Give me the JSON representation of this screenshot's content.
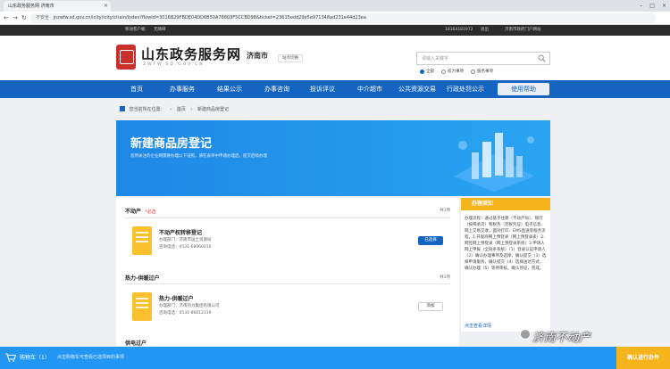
{
  "browser": {
    "tab_title": "山东政务服务网 济南市",
    "url_insecure": "不安全",
    "url": "jnzwfw.sd.gov.cn/icity/icity/chain/index?flowId=3016B29FBDE04DD6B50A78803F5CCBD98&ticket=23615edd29e5e971348ad231e44d23ea"
  },
  "topbar": {
    "left": "移动客户端",
    "left2": "无障碍",
    "phone": "18364181972",
    "logout": "退出",
    "portal": "济南市政府门户网站"
  },
  "header": {
    "title": "山东政务服务网",
    "subtitle": "ZWFW.SD.GOV.CN",
    "city": "济南市",
    "city_switch": "站点切换",
    "search_placeholder": "请输入关键字",
    "radios": [
      {
        "label": "全部",
        "selected": true
      },
      {
        "label": "权力事项",
        "selected": false
      },
      {
        "label": "服务事项",
        "selected": false
      }
    ]
  },
  "nav": {
    "items": [
      "首页",
      "办事服务",
      "结果公示",
      "办事咨询",
      "投诉评议",
      "中介超市",
      "公共资源交易",
      "行政处罚公示"
    ],
    "cta": "使用帮助"
  },
  "breadcrumb": {
    "prefix": "您当前所在位置：",
    "home": "首页",
    "current": "新建商品房登记"
  },
  "banner": {
    "title": "新建商品房登记",
    "subtitle": "您所关注的企业网需要办理以下证照，请在表单中申请办理后，提交后续办理"
  },
  "sections": [
    {
      "title": "不动产",
      "tag": "*必选",
      "count": "共1项"
    },
    {
      "title": "热力-供暖过户",
      "count": "共1项"
    },
    {
      "title": "供电过户"
    }
  ],
  "cards": [
    {
      "title": "不动产权转移登记",
      "dept": "办理部门：济南市国土资源局",
      "phone": "咨询电话：0531-68966010",
      "action": "已选择"
    },
    {
      "title": "热力-供暖过户",
      "dept": "办理部门：济南热力集团有限公司",
      "phone": "咨询电话：0531-86812319",
      "action": "添加"
    }
  ],
  "side": {
    "title": "办理须知",
    "text": "办理流程：通过基于住建（不动产局）、银行（按揭承贷）和税务（完税凭证）电子信息、网上交易交收，面对打印、EMS直送等服务流程。1.开发商网上预登录（网上预登录表）2.网签网上预登录（网上预登录系统）3.申请人网上申报（全链条系统）（1）登录认证申请人（2）确认办理事项及选择，确认提交（3）选择申请服务，确认提交（4）选择送达方式，确认办理（5）等待审核，确认领证，完成。",
    "more": "点击查看详情"
  },
  "cart": {
    "label": "购物车（1）",
    "tip": "点击购物车可查看已选项目的事项",
    "cta": "确认进行办件"
  },
  "watermark": "济南不动产",
  "colors": {
    "nav_blue": "#1565c0",
    "banner_blue": "#1e88e5",
    "accent_yellow": "#f5b31c",
    "cart_blue": "#2196f3"
  }
}
